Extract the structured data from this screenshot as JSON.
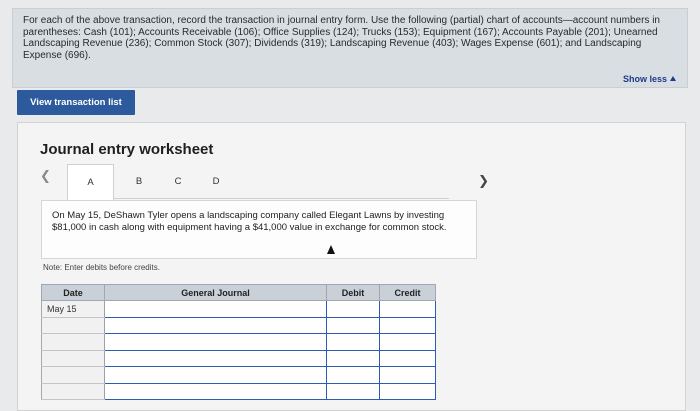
{
  "instructions": {
    "text": "For each of the above transaction, record the transaction in journal entry form. Use the following (partial) chart of accounts—account numbers in parentheses: Cash (101); Accounts Receivable (106); Office Supplies (124); Trucks (153); Equipment (167); Accounts Payable (201); Unearned Landscaping Revenue (236); Common Stock (307); Dividends (319); Landscaping Revenue (403); Wages Expense (601); and Landscaping Expense (696).",
    "show_less_label": "Show less"
  },
  "view_transaction_list_label": "View transaction list",
  "worksheet": {
    "title": "Journal entry worksheet",
    "prev_icon": "chevron-left-icon",
    "next_icon": "chevron-right-icon",
    "tabs": [
      "A",
      "B",
      "C",
      "D"
    ],
    "active_tab": "A",
    "description": "On May 15, DeShawn Tyler opens a landscaping company called Elegant Lawns by investing $81,000 in cash along with equipment having a $41,000 value in exchange for common stock.",
    "note": "Note: Enter debits before credits.",
    "table": {
      "headers": [
        "Date",
        "General Journal",
        "Debit",
        "Credit"
      ],
      "rows": [
        {
          "date": "May 15"
        },
        {
          "date": ""
        },
        {
          "date": ""
        },
        {
          "date": ""
        },
        {
          "date": ""
        },
        {
          "date": ""
        }
      ]
    }
  },
  "colors": {
    "button_bg": "#2d5a9c",
    "link": "#1d3c8a",
    "header_bg": "#c9d0d8",
    "input_border": "#2e5caf"
  }
}
